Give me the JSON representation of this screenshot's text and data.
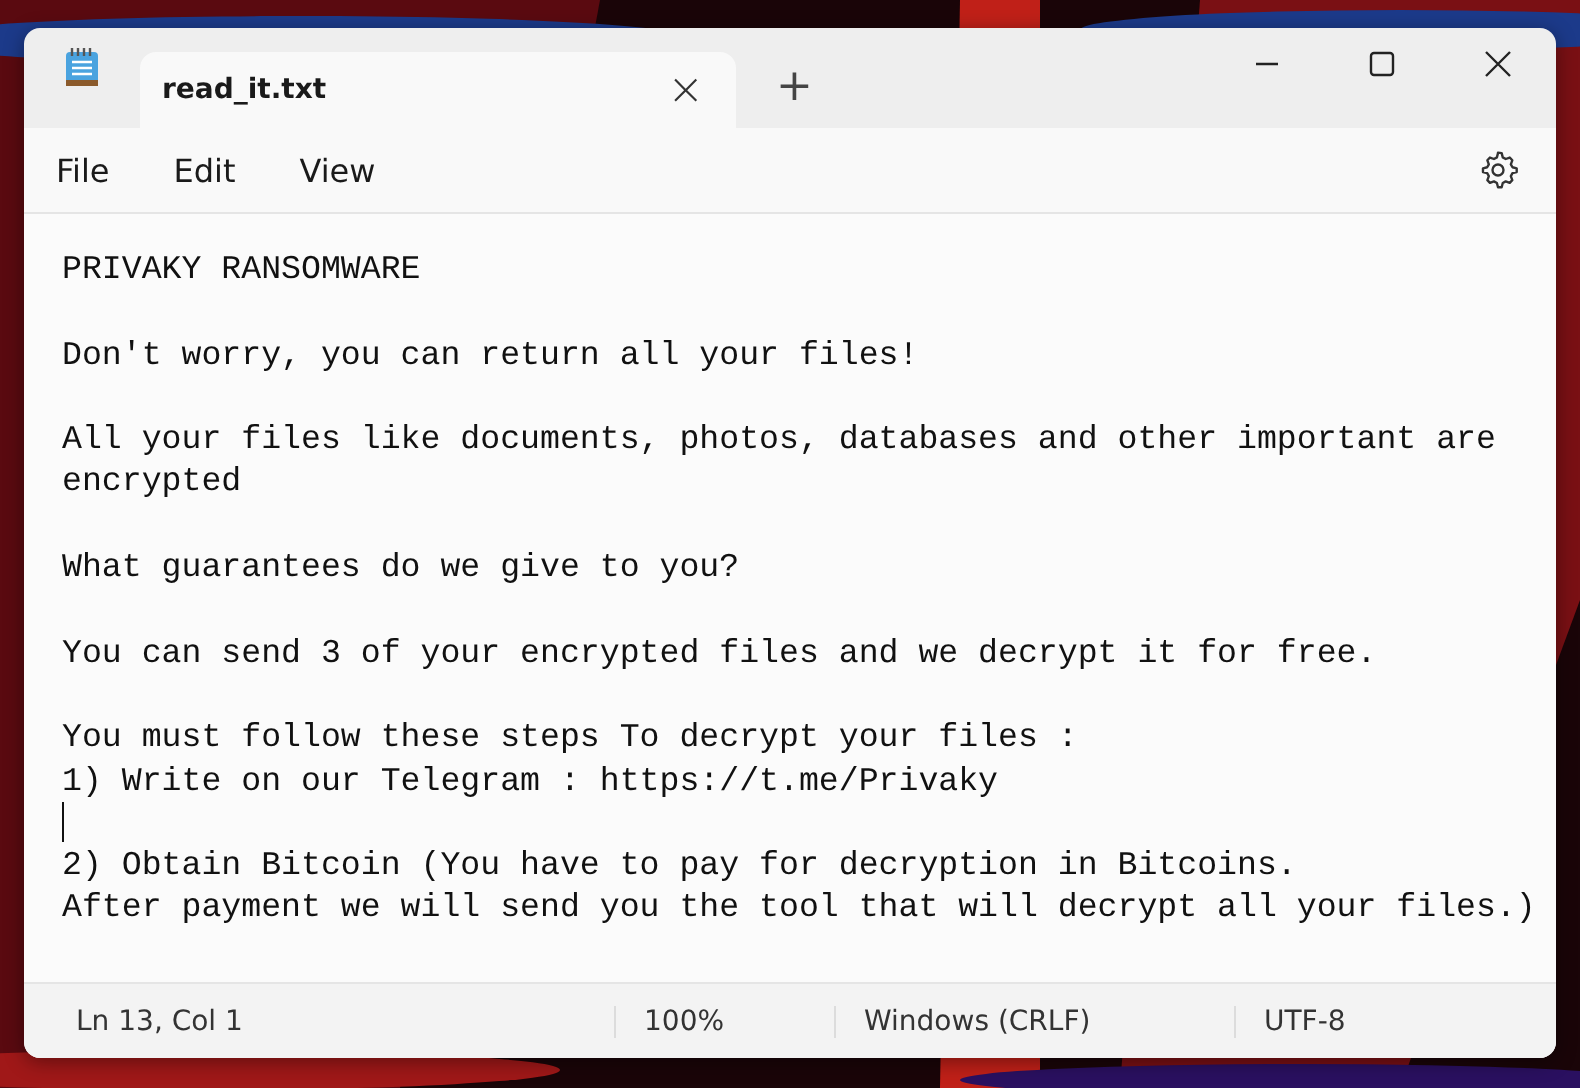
{
  "tabs": [
    {
      "label": "read_it.txt",
      "selected": true,
      "close": "×"
    }
  ],
  "new_tab": "+",
  "menu": [
    "File",
    "Edit",
    "View"
  ],
  "editor": {
    "lines": [
      {
        "kind": "text",
        "text": "PRIVAKY RANSOMWARE"
      },
      {
        "kind": "blank"
      },
      {
        "kind": "text",
        "text": "Don't worry, you can return all your files!"
      },
      {
        "kind": "blank"
      },
      {
        "kind": "text",
        "text": "All your files like documents, photos, databases and other important are"
      },
      {
        "kind": "text",
        "text": "encrypted"
      },
      {
        "kind": "blank"
      },
      {
        "kind": "text",
        "text": "What guarantees do we give to you?"
      },
      {
        "kind": "blank"
      },
      {
        "kind": "text",
        "text": "You can send 3 of your encrypted files and we decrypt it for free."
      },
      {
        "kind": "blank"
      },
      {
        "kind": "text",
        "text": "You must follow these steps To decrypt your files :"
      },
      {
        "kind": "text",
        "text": "1) Write on our Telegram : https://t.me/Privaky"
      },
      {
        "kind": "caret"
      },
      {
        "kind": "text",
        "text": "2) Obtain Bitcoin (You have to pay for decryption in Bitcoins."
      },
      {
        "kind": "text",
        "text": "After payment we will send you the tool that will decrypt all your files.)"
      }
    ]
  },
  "status_bar": [
    "Ln 13, Col 1",
    "100%",
    "Windows (CRLF)",
    "UTF-8"
  ]
}
